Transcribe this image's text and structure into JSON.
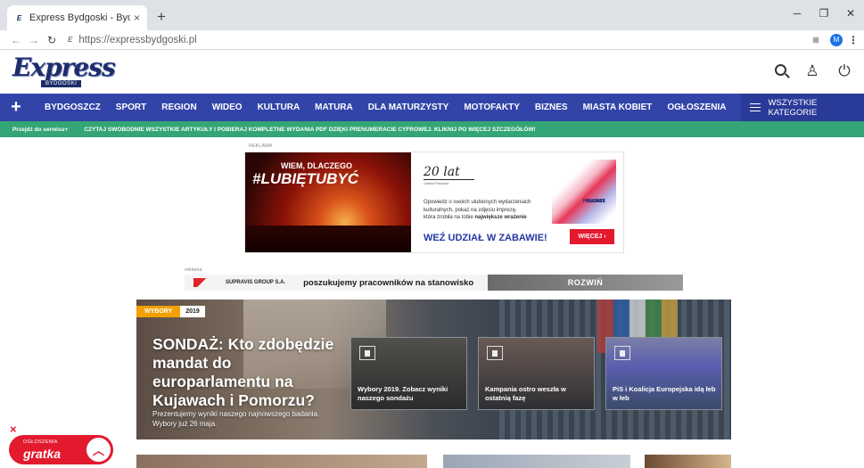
{
  "browser": {
    "tab_title": "Express Bydgoski - Bydgoszcz, K",
    "tab_close": "×",
    "new_tab": "+",
    "url": "https://expressbydgoski.pl",
    "profile_initial": "M"
  },
  "site": {
    "logo_main": "Express",
    "logo_sub": "BYDGOSKI"
  },
  "nav": {
    "items": [
      "BYDGOSZCZ",
      "SPORT",
      "REGION",
      "WIDEO",
      "KULTURA",
      "MATURA",
      "DLA MATURZYSTY",
      "MOTOFAKTY",
      "BIZNES",
      "MIASTA KOBIET",
      "OGŁOSZENIA"
    ],
    "all_categories": "WSZYSTKIE KATEGORIE"
  },
  "subbar": {
    "go": "Przejdź do serwisu+",
    "promo": "CZYTAJ SWOBODNIE WSZYSTKIE ARTYKUŁY I POBIERAJ KOMPLETNE WYDANIA PDF DZIĘKI PRENUMERACIE CYFROWEJ. KLIKNIJ PO WIĘCEJ SZCZEGÓŁÓW!"
  },
  "ad1": {
    "label": "REKLAMA",
    "small": "WIEM, DLACZEGO",
    "big": "#LUBIĘTUBYĆ",
    "years": "20 lat",
    "region_line1": "KUJAWY",
    "region_line2": "POMORZE",
    "copy_line1": "Opowiedz o swoich ulubionych wydarzeniach",
    "copy_line2": "kulturalnych, pokaż na zdjęciu imprezę,",
    "copy_line3_a": "która zrobiła na tobie ",
    "copy_line3_b": "największe wrażenie",
    "cta": "WEŹ UDZIAŁ W ZABAWIE!",
    "button": "WIĘCEJ ›"
  },
  "ad2": {
    "label": "reklama",
    "company": "SUPRAVIS GROUP S.A.",
    "message": "poszukujemy pracowników na stanowisko",
    "expand": "ROZWIŃ"
  },
  "hero": {
    "tag": "WYBORY",
    "tag_year": "2019",
    "title": "SONDAŻ: Kto zdobędzie mandat do europarlamentu na Kujawach i Pomorzu?",
    "lead": "Prezentujemy wyniki naszego najnowszego badania. Wybory już 26 maja.",
    "cards": [
      {
        "title": "Wybory 2019. Zobacz wyniki naszego sondażu"
      },
      {
        "title": "Kampania ostro weszła w ostatnią fazę"
      },
      {
        "title": "PiS i Koalicja Europejska idą łeb w łeb"
      }
    ]
  },
  "ogloszenia": {
    "small": "OGŁOSZENIA",
    "brand": "gratka",
    "close": "×"
  }
}
